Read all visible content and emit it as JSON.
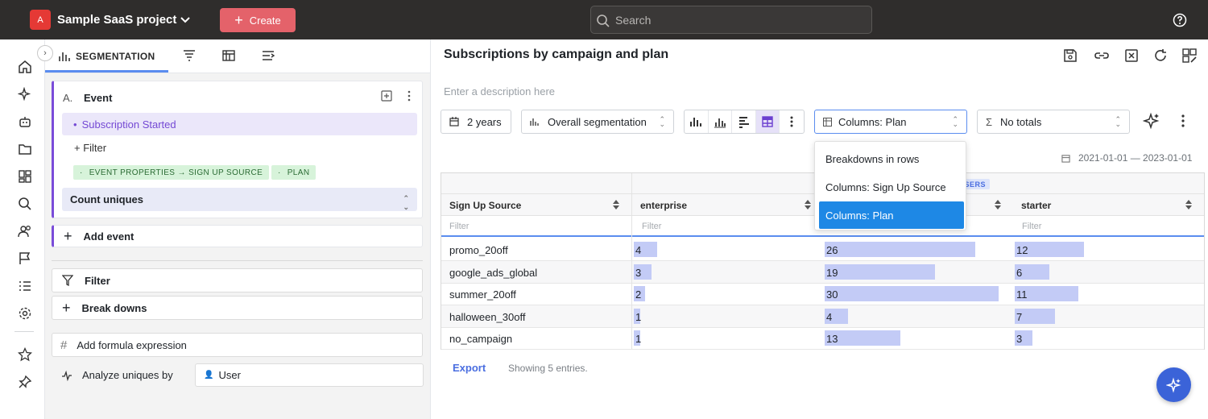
{
  "topbar": {
    "project_initial": "A",
    "project_name": "Sample SaaS project",
    "create_label": "Create",
    "search_placeholder": "Search"
  },
  "left": {
    "tabs": {
      "segmentation": "SEGMENTATION"
    },
    "event_card": {
      "letter": "A.",
      "title": "Event",
      "selected_event": "Subscription Started",
      "filter_label": "+ Filter",
      "chips": [
        "EVENT PROPERTIES → SIGN UP SOURCE",
        "PLAN"
      ],
      "count_label": "Count uniques"
    },
    "add_event_label": "Add event",
    "filter_label": "Filter",
    "breakdowns_label": "Break downs",
    "formula_label": "Add formula expression",
    "analyze_label": "Analyze uniques by",
    "analyze_value": "User"
  },
  "main": {
    "title": "Subscriptions by campaign and plan",
    "description_placeholder": "Enter a description here",
    "controls": {
      "range": "2 years",
      "segmentation": "Overall segmentation",
      "columns": "Columns: Plan",
      "totals": "No totals"
    },
    "date_range": "2021-01-01 — 2023-01-01",
    "table": {
      "group_badge": "E USERS",
      "row_header": "Sign Up Source",
      "filter_placeholder": "Filter",
      "columns": [
        "enterprise",
        "",
        "starter"
      ],
      "rows": [
        {
          "label": "promo_20off",
          "values": [
            4,
            26,
            12
          ]
        },
        {
          "label": "google_ads_global",
          "values": [
            3,
            19,
            6
          ]
        },
        {
          "label": "summer_20off",
          "values": [
            2,
            30,
            11
          ]
        },
        {
          "label": "halloween_30off",
          "values": [
            1,
            4,
            7
          ]
        },
        {
          "label": "no_campaign",
          "values": [
            1,
            13,
            3
          ]
        }
      ],
      "max_value": 30
    },
    "footer": {
      "export_label": "Export",
      "showing": "Showing 5 entries."
    },
    "dropdown": {
      "options": [
        "Breakdowns in rows",
        "Columns: Sign Up Source",
        "Columns: Plan"
      ],
      "selected_index": 2
    }
  },
  "colors": {
    "brand_red": "#e53935",
    "create": "#e4626a",
    "accent_purple": "#7a4cd9",
    "bar": "#c3cbf6",
    "selected_blue": "#1e88e5",
    "link_blue": "#4a6ee0"
  }
}
